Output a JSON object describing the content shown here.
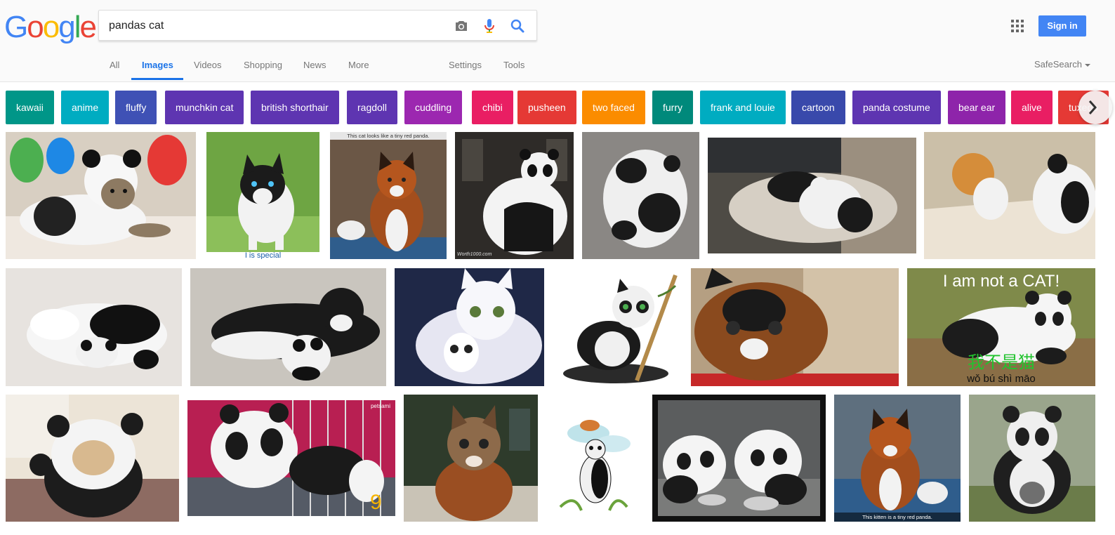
{
  "logo": {
    "letters": [
      "G",
      "o",
      "o",
      "g",
      "l",
      "e"
    ],
    "colors": [
      "#4285f4",
      "#ea4335",
      "#fbbc05",
      "#4285f4",
      "#34a853",
      "#ea4335"
    ]
  },
  "search": {
    "query": "pandas cat",
    "camera_icon": "camera-icon",
    "mic_icon": "mic-icon",
    "search_icon": "search-icon"
  },
  "header": {
    "apps_icon": "apps-grid-icon",
    "signin_label": "Sign in"
  },
  "nav": {
    "tabs": [
      {
        "label": "All",
        "active": false
      },
      {
        "label": "Images",
        "active": true
      },
      {
        "label": "Videos",
        "active": false
      },
      {
        "label": "Shopping",
        "active": false
      },
      {
        "label": "News",
        "active": false
      },
      {
        "label": "More",
        "active": false
      }
    ],
    "settings_label": "Settings",
    "tools_label": "Tools",
    "safesearch_label": "SafeSearch"
  },
  "chips": [
    {
      "label": "kawaii",
      "color": "#009688"
    },
    {
      "label": "anime",
      "color": "#00acc1"
    },
    {
      "label": "fluffy",
      "color": "#3f51b5"
    },
    {
      "label": "munchkin cat",
      "color": "#5e35b1"
    },
    {
      "label": "british shorthair",
      "color": "#5e35b1"
    },
    {
      "label": "ragdoll",
      "color": "#5e35b1"
    },
    {
      "label": "cuddling",
      "color": "#9c27b0"
    },
    {
      "label": "chibi",
      "color": "#e91e63"
    },
    {
      "label": "pusheen",
      "color": "#e53935"
    },
    {
      "label": "two faced",
      "color": "#fb8c00"
    },
    {
      "label": "furry",
      "color": "#00897b"
    },
    {
      "label": "frank and louie",
      "color": "#00acc1"
    },
    {
      "label": "cartoon",
      "color": "#3949ab"
    },
    {
      "label": "panda costume",
      "color": "#5e35b1"
    },
    {
      "label": "bear ear",
      "color": "#8e24aa"
    },
    {
      "label": "alive",
      "color": "#e91e63"
    },
    {
      "label": "tuxedo",
      "color": "#e53935"
    }
  ],
  "chip_next_icon": "chevron-right-icon",
  "image_text": {
    "r1_2_caption": "I is special",
    "r1_3_caption": "This cat looks like a tiny red panda.",
    "r1_4_watermark": "Worth1000.com",
    "r2_6_title": "I am not a CAT!",
    "r2_6_chinese": "我不是猫",
    "r2_6_pinyin": "wǒ bú shì māo",
    "r3_2_watermark": "petsami",
    "r3_2_number": "9",
    "r3_6_caption": "This kitten is a tiny red panda."
  }
}
